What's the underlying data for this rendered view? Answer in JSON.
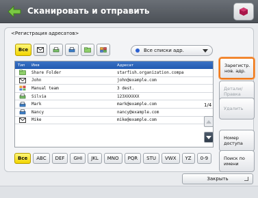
{
  "header": {
    "title": "Сканировать и отправить"
  },
  "subtitle": "<Регистрация адресатов>",
  "filters": {
    "all_label": "Все"
  },
  "list_selector": {
    "value": "Все списки адр."
  },
  "table": {
    "headers": {
      "type": "Тип",
      "name": "Имя",
      "address": "Адресат"
    },
    "rows": [
      {
        "icon": "shared-folder-icon",
        "name": "Share Folder",
        "address": "starfish.organization.compa"
      },
      {
        "icon": "email-icon",
        "name": "John",
        "address": "john@example.com"
      },
      {
        "icon": "group-icon",
        "name": "Manual team",
        "address": "3 dest."
      },
      {
        "icon": "fax-icon",
        "name": "Silvia",
        "address": "123XXXXXX"
      },
      {
        "icon": "ifax-icon",
        "name": "Mark",
        "address": "mark@example.com"
      },
      {
        "icon": "ifax-icon",
        "name": "Nancy",
        "address": "nancy@example.com"
      },
      {
        "icon": "email-icon",
        "name": "Mike",
        "address": "mike@example.com"
      }
    ]
  },
  "pager": {
    "page": "1/4"
  },
  "right_panel": {
    "register": "Зарегистр. нов. адр.",
    "details": "Детали/ Правка",
    "delete": "Удалить",
    "access_number": "Номер доступа",
    "search_by_name": "Поиск по имени"
  },
  "alpha_index": [
    "Все",
    "ABC",
    "DEF",
    "GHI",
    "JKL",
    "MNO",
    "PQR",
    "STU",
    "VWX",
    "YZ",
    "0-9"
  ],
  "footer": {
    "close": "Закрыть"
  },
  "colors": {
    "accent": "#f07a1a",
    "header_blue": "#225ab0",
    "active_yellow": "#f2d500"
  }
}
